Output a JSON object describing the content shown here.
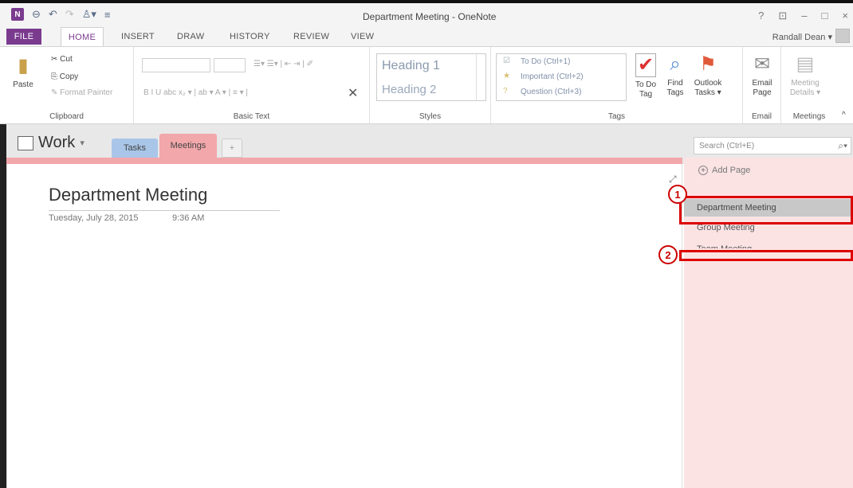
{
  "window": {
    "title": "Department Meeting - OneNote",
    "app_logo": "N",
    "controls": [
      "?",
      "⊡",
      "–",
      "□",
      "×"
    ]
  },
  "ribbon_tabs": [
    "FILE",
    "HOME",
    "INSERT",
    "DRAW",
    "HISTORY",
    "REVIEW",
    "VIEW"
  ],
  "user": {
    "name": "Randall Dean ▾"
  },
  "ribbon": {
    "clipboard": {
      "label": "Clipboard",
      "paste": "Paste",
      "cut": "Cut",
      "copy": "Copy",
      "format_painter": "Format Painter"
    },
    "basic_text": {
      "label": "Basic Text"
    },
    "styles": {
      "label": "Styles",
      "heading1": "Heading 1",
      "heading2": "Heading 2"
    },
    "tags": {
      "label": "Tags",
      "todo": "To Do (Ctrl+1)",
      "important": "Important (Ctrl+2)",
      "question": "Question (Ctrl+3)",
      "todo_tag": "To Do Tag",
      "find_tags": "Find Tags",
      "outlook_tasks": "Outlook Tasks ▾"
    },
    "email": {
      "label": "Email",
      "email_page": "Email Page"
    },
    "meetings": {
      "label": "Meetings",
      "meeting_details": "Meeting Details ▾"
    }
  },
  "notebook": {
    "name": "Work",
    "sections": [
      "Tasks",
      "Meetings",
      "+"
    ],
    "search_placeholder": "Search (Ctrl+E)"
  },
  "page": {
    "title": "Department Meeting",
    "date": "Tuesday, July 28, 2015",
    "time": "9:36 AM"
  },
  "pages_panel": {
    "add_page": "Add Page",
    "items": [
      "Department Meeting",
      "Group Meeting",
      "Team Meeting"
    ]
  },
  "callouts": [
    "1",
    "2"
  ],
  "colors": {
    "accent": "#7a3b8f",
    "section_meetings": "#f2a7ab",
    "section_tasks": "#a9c6e8",
    "highlight": "#dd0000"
  }
}
